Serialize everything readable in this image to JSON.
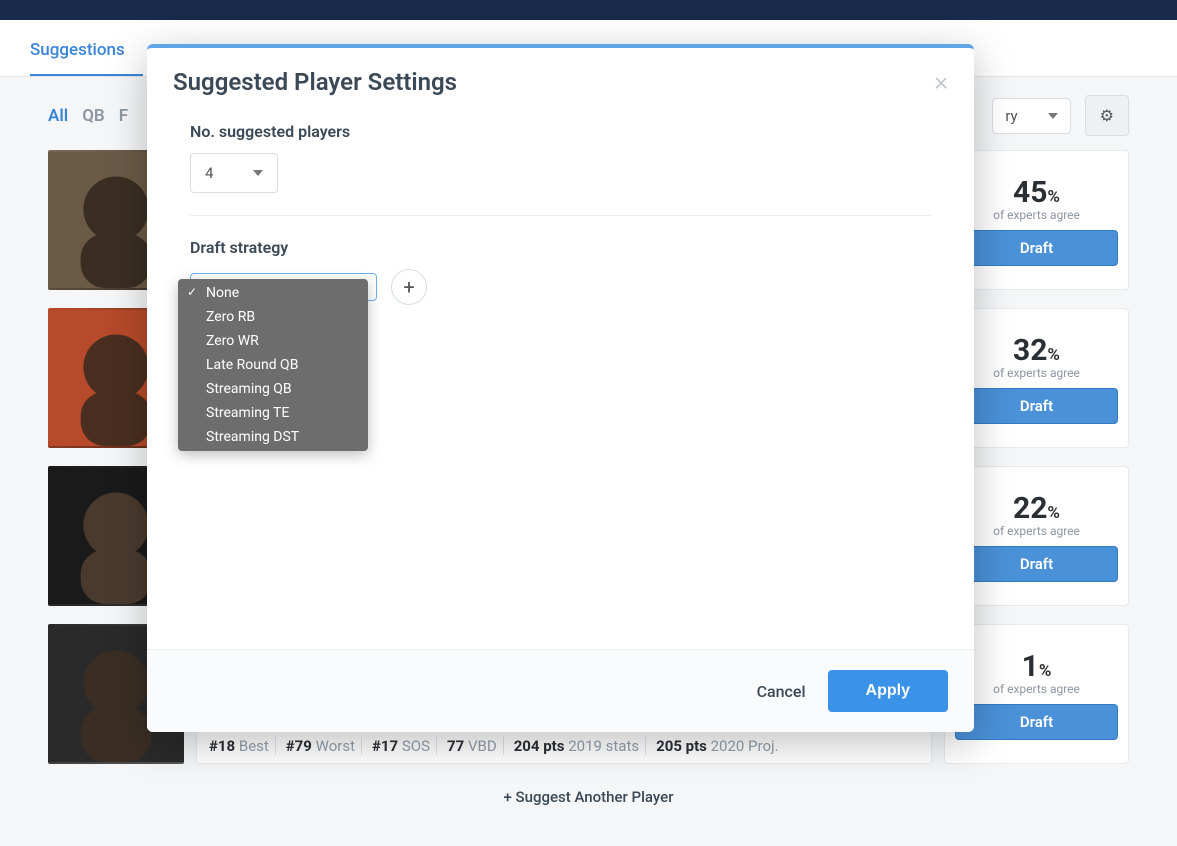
{
  "nav": {
    "tabs": [
      "Suggestions"
    ],
    "active": 0
  },
  "filters": {
    "pills": [
      "All",
      "QB",
      "F"
    ],
    "active": 0,
    "select_value": "ry"
  },
  "gear_icon": "⚙",
  "players": [
    {
      "pct": "45",
      "experts_label": "of experts agree",
      "draft_label": "Draft"
    },
    {
      "pct": "32",
      "experts_label": "of experts agree",
      "draft_label": "Draft"
    },
    {
      "pct": "22",
      "experts_label": "of experts agree",
      "draft_label": "Draft"
    },
    {
      "pct": "1",
      "experts_label": "of experts agree",
      "draft_label": "Draft",
      "stats": [
        {
          "num": "#18",
          "label": "Best"
        },
        {
          "num": "#79",
          "label": "Worst"
        },
        {
          "num": "#17",
          "label": "SOS"
        },
        {
          "num": "77",
          "label": "VBD"
        },
        {
          "num": "204 pts",
          "label": "2019 stats"
        },
        {
          "num": "205 pts",
          "label": "2020 Proj."
        }
      ]
    }
  ],
  "suggest_another": "+ Suggest Another Player",
  "pct_sign": "%",
  "modal": {
    "title": "Suggested Player Settings",
    "num_label": "No. suggested players",
    "num_value": "4",
    "strategy_label": "Draft strategy",
    "strategy_value": "",
    "cancel": "Cancel",
    "apply": "Apply",
    "close": "×",
    "plus": "+",
    "dropdown": {
      "selected_index": 0,
      "options": [
        "None",
        "Zero RB",
        "Zero WR",
        "Late Round QB",
        "Streaming QB",
        "Streaming TE",
        "Streaming DST"
      ]
    }
  }
}
